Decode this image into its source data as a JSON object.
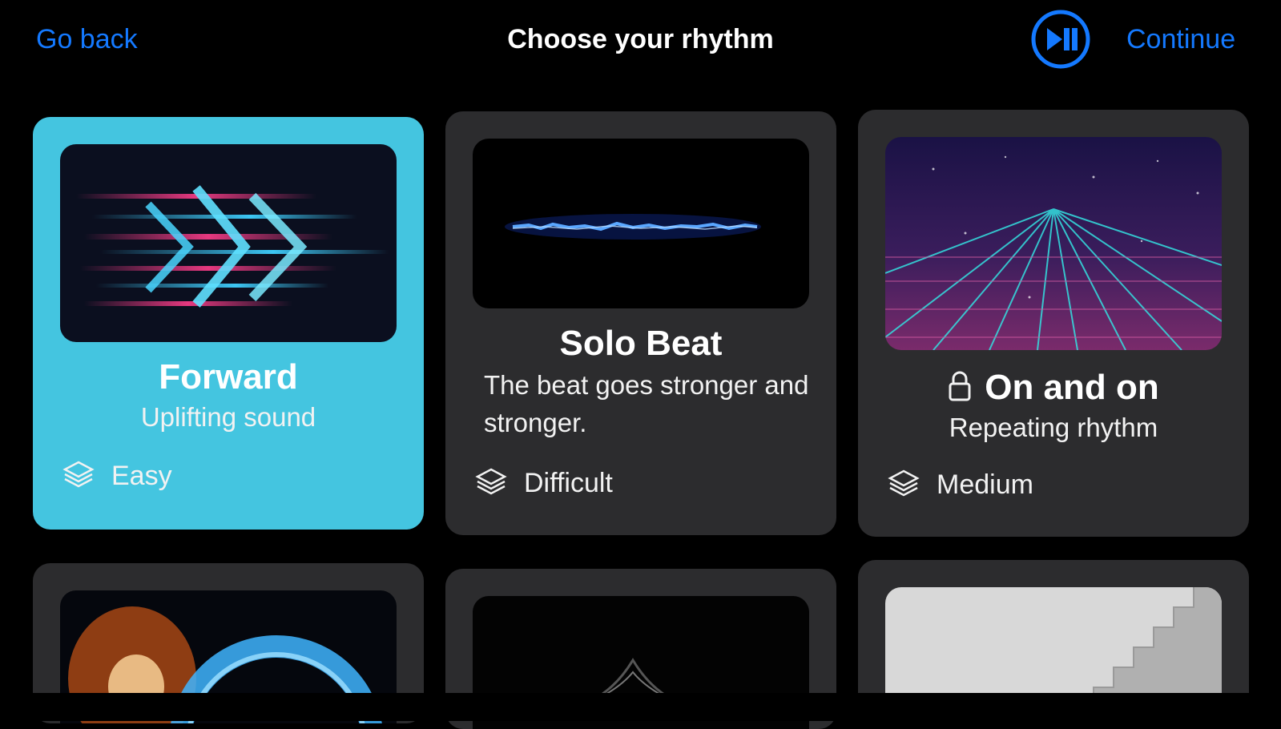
{
  "header": {
    "back_label": "Go back",
    "title": "Choose your rhythm",
    "continue_label": "Continue",
    "accent_color": "#1479ff"
  },
  "cards": [
    {
      "title": "Forward",
      "subtitle": "Uplifting sound",
      "difficulty": "Easy",
      "selected": true,
      "locked": false,
      "color": "#44c5e0"
    },
    {
      "title": "Solo Beat",
      "subtitle": "The beat goes stronger and stronger.",
      "difficulty": "Difficult",
      "selected": false,
      "locked": false
    },
    {
      "title": "On and on",
      "subtitle": "Repeating rhythm",
      "difficulty": "Medium",
      "selected": false,
      "locked": true
    }
  ],
  "icons": {
    "play_pause": "play-pause-icon",
    "difficulty": "layers-icon",
    "lock": "lock-icon"
  }
}
